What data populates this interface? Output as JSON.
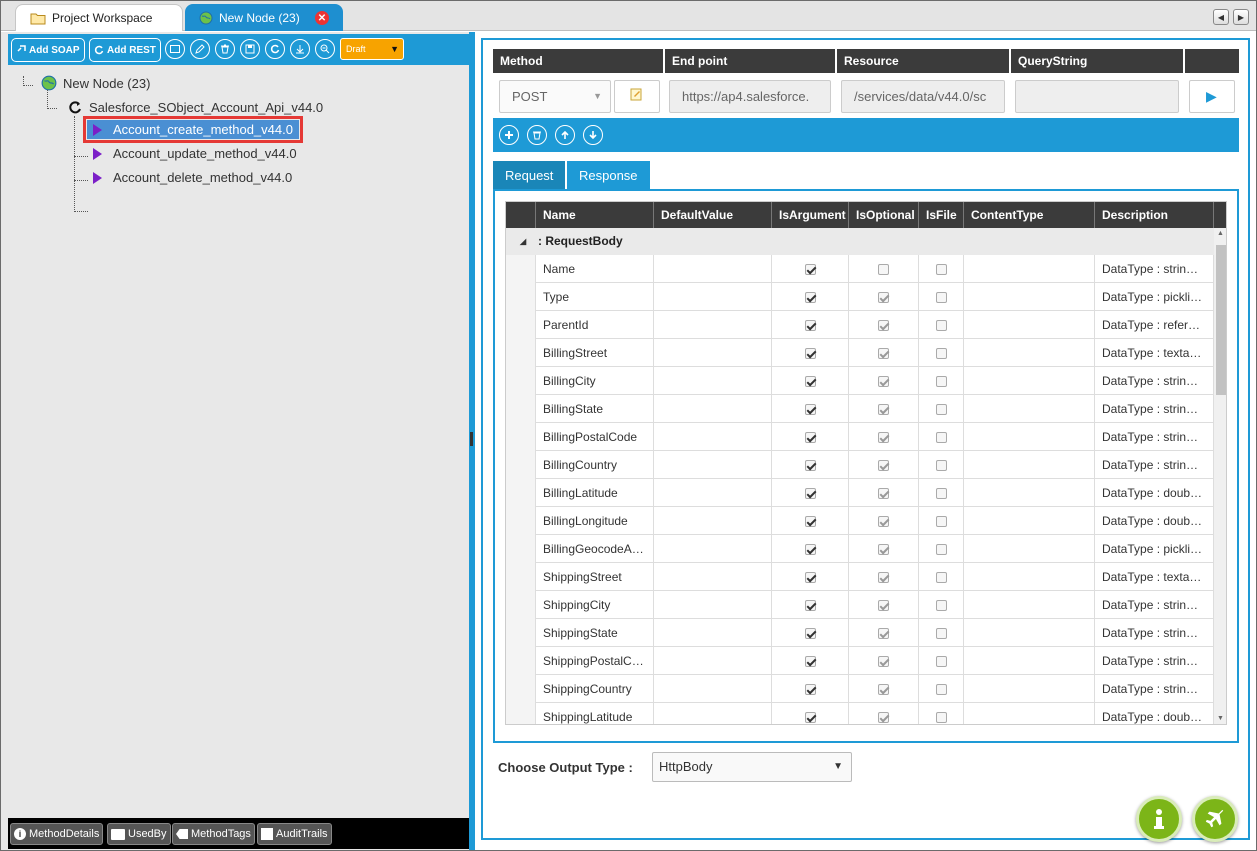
{
  "tabs": [
    {
      "label": "Project Workspace"
    },
    {
      "label": "New Node (23)"
    }
  ],
  "toolbar": {
    "add_soap": "Add SOAP",
    "add_rest": "Add REST",
    "status": "Draft"
  },
  "tree": {
    "root": "New Node (23)",
    "api": "Salesforce_SObject_Account_Api_v44.0",
    "methods": [
      "Account_create_method_v44.0",
      "Account_update_method_v44.0",
      "Account_delete_method_v44.0"
    ]
  },
  "bottom": {
    "method_details": "MethodDetails",
    "used_by": "UsedBy",
    "method_tags": "MethodTags",
    "audit_trails": "AuditTrails"
  },
  "endpoint": {
    "headers": {
      "method": "Method",
      "endpoint": "End point",
      "resource": "Resource",
      "query": "QueryString"
    },
    "method": "POST",
    "endpoint": "https://ap4.salesforce.",
    "resource": "/services/data/v44.0/sc",
    "query": ""
  },
  "subtabs": {
    "request": "Request",
    "response": "Response"
  },
  "grid": {
    "columns": [
      "Name",
      "DefaultValue",
      "IsArgument",
      "IsOptional",
      "IsFile",
      "ContentType",
      "Description"
    ],
    "group": ": RequestBody",
    "rows": [
      {
        "name": "Name",
        "arg": true,
        "opt": false,
        "desc": "DataType : strin…"
      },
      {
        "name": "Type",
        "arg": true,
        "opt": true,
        "desc": "DataType : pickli…"
      },
      {
        "name": "ParentId",
        "arg": true,
        "opt": true,
        "desc": "DataType : refer…"
      },
      {
        "name": "BillingStreet",
        "arg": true,
        "opt": true,
        "desc": "DataType : texta…"
      },
      {
        "name": "BillingCity",
        "arg": true,
        "opt": true,
        "desc": "DataType : strin…"
      },
      {
        "name": "BillingState",
        "arg": true,
        "opt": true,
        "desc": "DataType : strin…"
      },
      {
        "name": "BillingPostalCode",
        "arg": true,
        "opt": true,
        "desc": "DataType : strin…"
      },
      {
        "name": "BillingCountry",
        "arg": true,
        "opt": true,
        "desc": "DataType : strin…"
      },
      {
        "name": "BillingLatitude",
        "arg": true,
        "opt": true,
        "desc": "DataType : doub…"
      },
      {
        "name": "BillingLongitude",
        "arg": true,
        "opt": true,
        "desc": "DataType : doub…"
      },
      {
        "name": "BillingGeocodeA…",
        "arg": true,
        "opt": true,
        "desc": "DataType : pickli…"
      },
      {
        "name": "ShippingStreet",
        "arg": true,
        "opt": true,
        "desc": "DataType : texta…"
      },
      {
        "name": "ShippingCity",
        "arg": true,
        "opt": true,
        "desc": "DataType : strin…"
      },
      {
        "name": "ShippingState",
        "arg": true,
        "opt": true,
        "desc": "DataType : strin…"
      },
      {
        "name": "ShippingPostalC…",
        "arg": true,
        "opt": true,
        "desc": "DataType : strin…"
      },
      {
        "name": "ShippingCountry",
        "arg": true,
        "opt": true,
        "desc": "DataType : strin…"
      },
      {
        "name": "ShippingLatitude",
        "arg": true,
        "opt": true,
        "desc": "DataType : doub…"
      }
    ]
  },
  "output": {
    "label": "Choose Output Type :",
    "value": "HttpBody"
  }
}
